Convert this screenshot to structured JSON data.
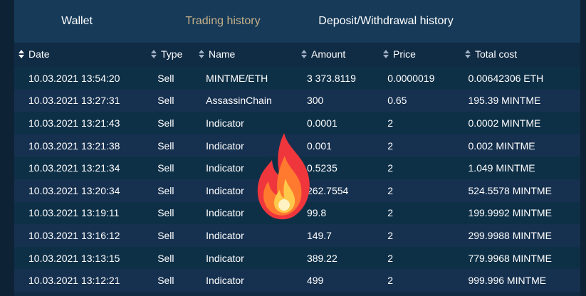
{
  "tabs": [
    {
      "label": "Wallet"
    },
    {
      "label": "Trading history"
    },
    {
      "label": "Deposit/Withdrawal history"
    }
  ],
  "colors": {
    "background": "#0e2236",
    "tabs_bar": "#163a58",
    "active_tab_text": "#c7b089",
    "row_odd": "#0e3047",
    "row_even": "#16304f"
  },
  "columns": [
    "Date",
    "Type",
    "Name",
    "Amount",
    "Price",
    "Total cost"
  ],
  "rows": [
    [
      "10.03.2021 13:54:20",
      "Sell",
      "MINTME/ETH",
      "3 373.8119",
      "0.0000019",
      "0.00642306 ETH"
    ],
    [
      "10.03.2021 13:27:31",
      "Sell",
      "AssassinChain",
      "300",
      "0.65",
      "195.39 MINTME"
    ],
    [
      "10.03.2021 13:21:43",
      "Sell",
      "Indicator",
      "0.0001",
      "2",
      "0.0002 MINTME"
    ],
    [
      "10.03.2021 13:21:38",
      "Sell",
      "Indicator",
      "0.001",
      "2",
      "0.002 MINTME"
    ],
    [
      "10.03.2021 13:21:34",
      "Sell",
      "Indicator",
      "0.5235",
      "2",
      "1.049 MINTME"
    ],
    [
      "10.03.2021 13:20:34",
      "Sell",
      "Indicator",
      "262.7554",
      "2",
      "524.5578 MINTME"
    ],
    [
      "10.03.2021 13:19:11",
      "Sell",
      "Indicator",
      "99.8",
      "2",
      "199.9992 MINTME"
    ],
    [
      "10.03.2021 13:16:12",
      "Sell",
      "Indicator",
      "149.7",
      "2",
      "299.9988 MINTME"
    ],
    [
      "10.03.2021 13:13:15",
      "Sell",
      "Indicator",
      "389.22",
      "2",
      "779.9968 MINTME"
    ],
    [
      "10.03.2021 13:12:21",
      "Sell",
      "Indicator",
      "499",
      "2",
      "999.996 MINTME"
    ]
  ],
  "overlay_icon": "fire-icon"
}
